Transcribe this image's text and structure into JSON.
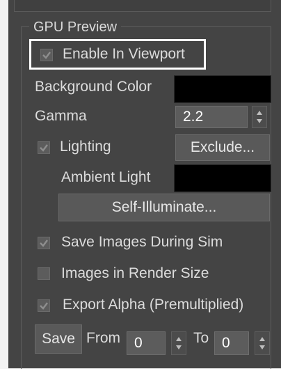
{
  "group": {
    "title": "GPU Preview"
  },
  "enable_viewport": {
    "label": "Enable In Viewport",
    "checked": true
  },
  "background_color": {
    "label": "Background Color",
    "color": "#000000"
  },
  "gamma": {
    "label": "Gamma",
    "value": "2.2"
  },
  "lighting": {
    "label": "Lighting",
    "checked": true,
    "exclude_label": "Exclude..."
  },
  "ambient_light": {
    "label": "Ambient Light",
    "color": "#000000"
  },
  "self_illuminate": {
    "label": "Self-Illuminate..."
  },
  "save_images": {
    "label": "Save Images During Sim",
    "checked": true
  },
  "render_size": {
    "label": "Images in Render Size",
    "checked": false
  },
  "export_alpha": {
    "label": "Export Alpha (Premultiplied)",
    "checked": true
  },
  "save_row": {
    "save_label": "Save",
    "from_label": "From",
    "from_value": "0",
    "to_label": "To",
    "to_value": "0"
  },
  "colors": {
    "panel_bg": "#444444",
    "text": "#dcdcdc",
    "highlight": "#ffffff"
  }
}
